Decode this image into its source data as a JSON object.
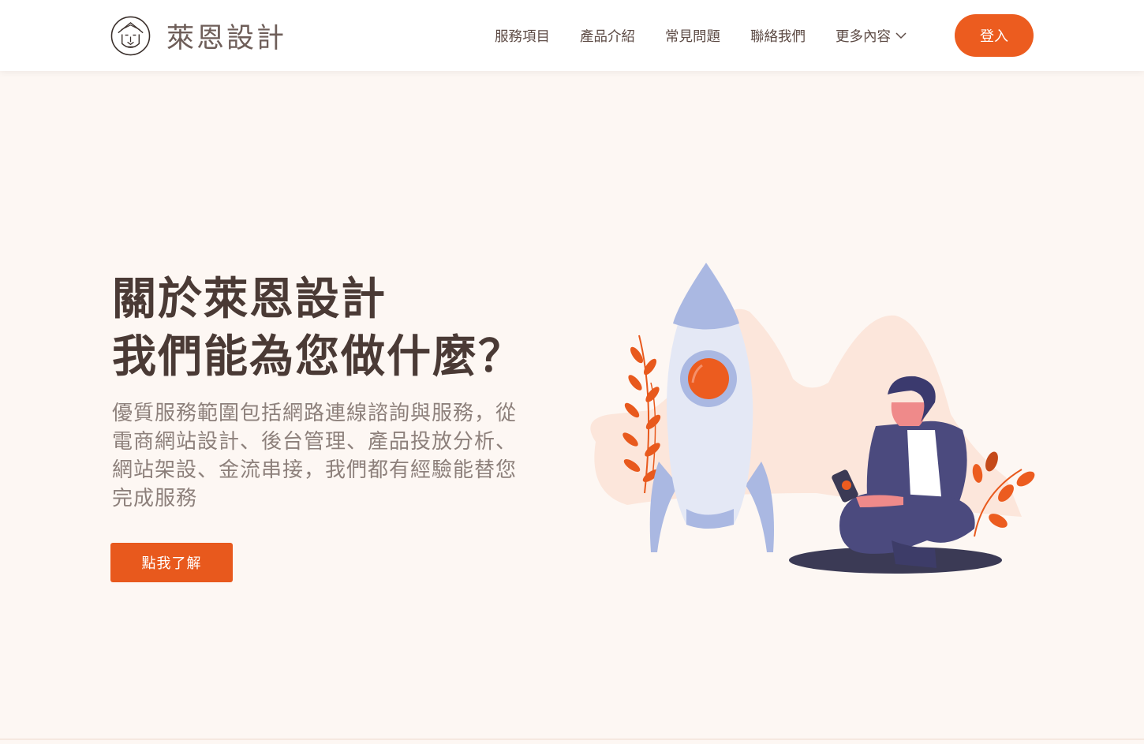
{
  "brand": {
    "name": "萊恩設計",
    "logo_icon": "lion-face-icon"
  },
  "nav": {
    "items": [
      {
        "label": "服務項目"
      },
      {
        "label": "產品介紹"
      },
      {
        "label": "常見問題"
      },
      {
        "label": "聯絡我們"
      }
    ],
    "more_label": "更多內容",
    "more_icon": "chevron-down-icon",
    "login_label": "登入"
  },
  "hero": {
    "title_line1": "關於萊恩設計",
    "title_line2": "我們能為您做什麼？",
    "desc_lines": [
      "優質服務範圍包括網路連線諮詢與服務，從",
      "電商網站設計、後台管理、產品投放分析、",
      "網站架設、金流串接，我們都有經驗能替您",
      "完成服務"
    ],
    "cta_label": "點我了解",
    "illustration": "rocket-and-person-illustration"
  },
  "colors": {
    "accent": "#ec5c1f",
    "background": "#fdf7f3",
    "title_text": "#4a3a35",
    "body_text": "#8d807b",
    "rocket": "#aab8e2",
    "person_suit": "#4b4a7e"
  }
}
